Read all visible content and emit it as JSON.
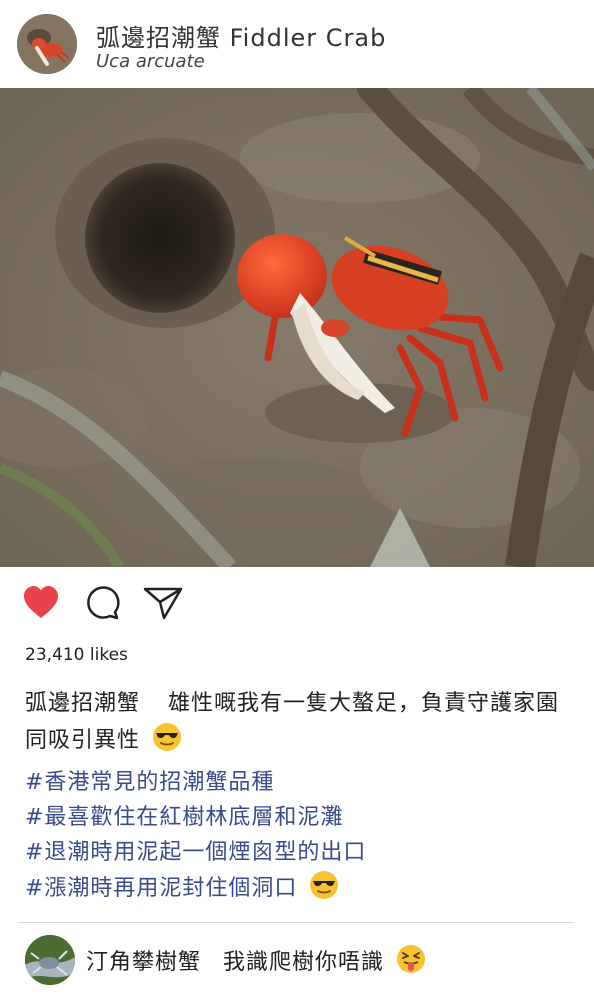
{
  "post": {
    "account_name": "弧邊招潮蟹  Fiddler Crab",
    "scientific_name": "Uca arcuate",
    "likes": "23,410 likes",
    "caption_user": "弧邊招潮蟹",
    "caption_text": "雄性嘅我有一隻大螯足，負責守護家園同吸引異性",
    "hashtags": [
      "#香港常見的招潮蟹品種",
      "#最喜歡住在紅樹林底層和泥灘",
      "#退潮時用泥起一個煙囪型的出口",
      "#漲潮時再用泥封住個洞口"
    ],
    "liked": true,
    "like_color": "#e8434d"
  },
  "comment": {
    "user": "汀角攀樹蟹",
    "text": "我識爬樹你唔識"
  },
  "icons": {
    "like": "heart-icon",
    "comment": "comment-bubble-icon",
    "share": "paper-plane-icon",
    "emoji_cool": "sunglasses-emoji-icon",
    "emoji_tongue": "squinting-tongue-emoji-icon"
  }
}
